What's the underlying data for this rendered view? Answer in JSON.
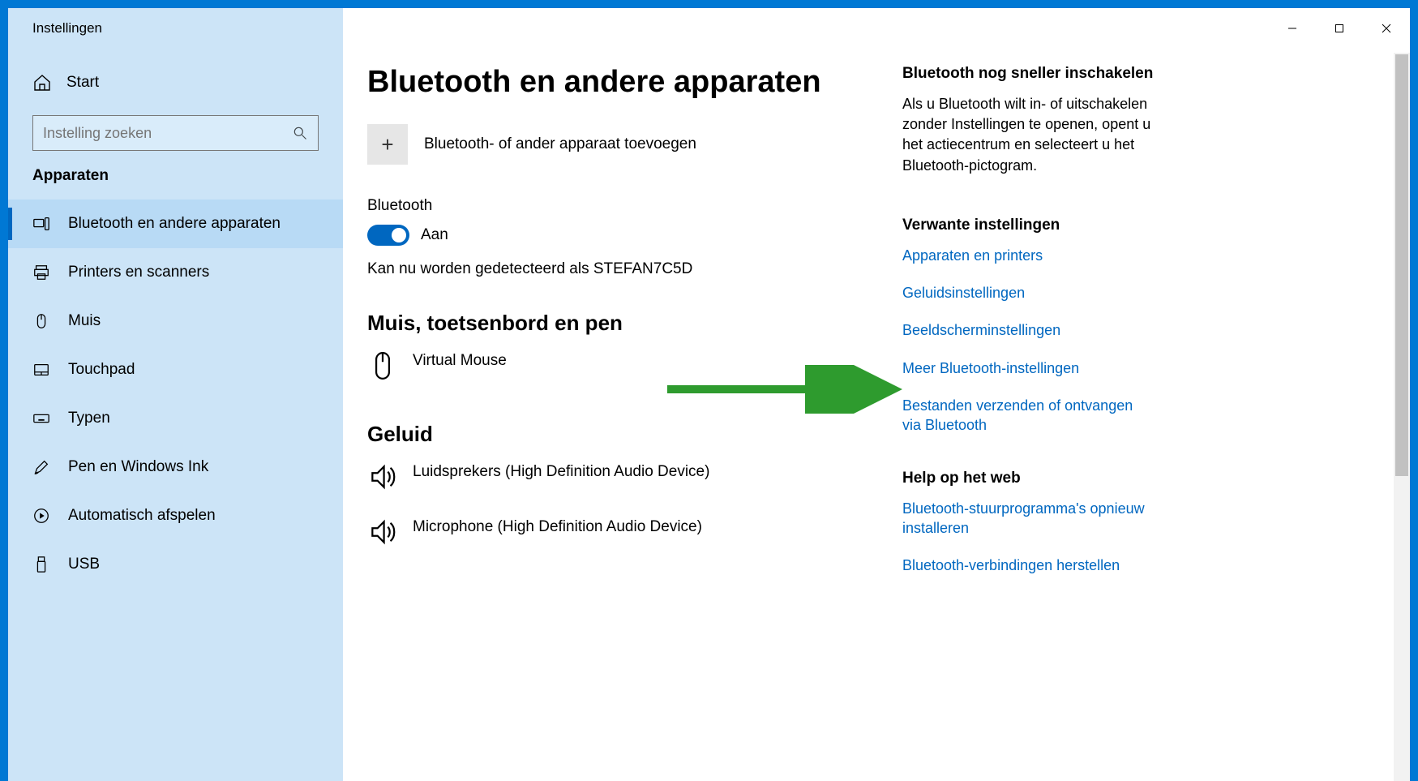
{
  "window": {
    "title": "Instellingen"
  },
  "sidebar": {
    "home_label": "Start",
    "search_placeholder": "Instelling zoeken",
    "section_label": "Apparaten",
    "items": [
      {
        "label": "Bluetooth en andere apparaten",
        "active": true
      },
      {
        "label": "Printers en scanners"
      },
      {
        "label": "Muis"
      },
      {
        "label": "Touchpad"
      },
      {
        "label": "Typen"
      },
      {
        "label": "Pen en Windows Ink"
      },
      {
        "label": "Automatisch afspelen"
      },
      {
        "label": "USB"
      }
    ]
  },
  "main": {
    "title": "Bluetooth en andere apparaten",
    "add_device_label": "Bluetooth- of ander apparaat toevoegen",
    "bluetooth_heading": "Bluetooth",
    "bluetooth_toggle_state": "Aan",
    "discoverable_text": "Kan nu worden gedetecteerd als STEFAN7C5D",
    "section_mouse": "Muis, toetsenbord en pen",
    "device_mouse": "Virtual Mouse",
    "section_sound": "Geluid",
    "device_speakers": "Luidsprekers (High Definition Audio Device)",
    "device_microphone": "Microphone (High Definition Audio Device)"
  },
  "right": {
    "tip_heading": "Bluetooth nog sneller inschakelen",
    "tip_body": "Als u Bluetooth wilt in- of uitschakelen zonder Instellingen te openen, opent u het actiecentrum en selecteert u het Bluetooth-pictogram.",
    "related_heading": "Verwante instellingen",
    "link_devices": "Apparaten en printers",
    "link_sound": "Geluidsinstellingen",
    "link_display": "Beeldscherminstellingen",
    "link_more_bt": "Meer Bluetooth-instellingen",
    "link_send": "Bestanden verzenden of ontvangen via Bluetooth",
    "help_heading": "Help op het web",
    "help_link1": "Bluetooth-stuurprogramma's opnieuw installeren",
    "help_link2": "Bluetooth-verbindingen herstellen"
  }
}
